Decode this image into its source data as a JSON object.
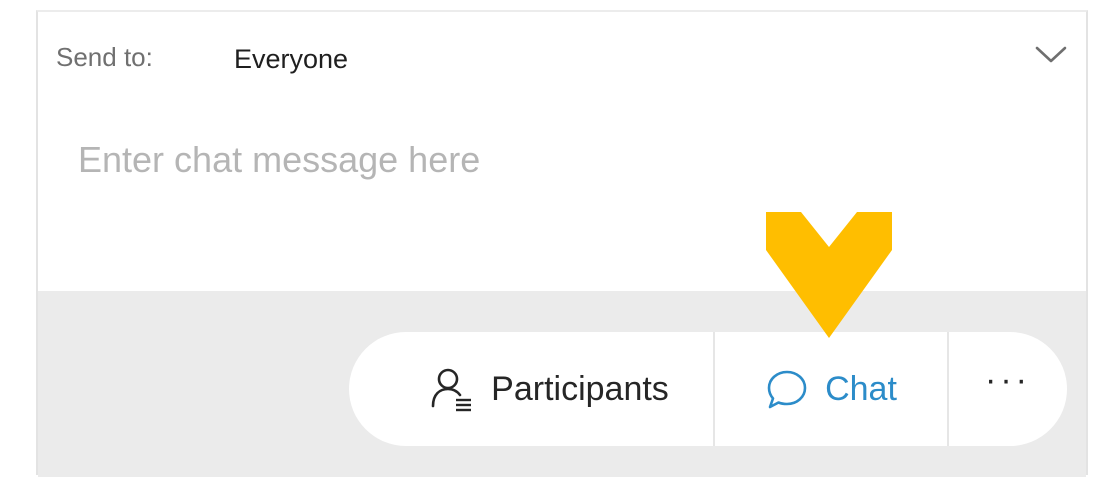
{
  "send_to": {
    "label": "Send to:",
    "value": "Everyone",
    "dropdown_icon": "chevron-down-icon"
  },
  "message": {
    "placeholder": "Enter chat message here",
    "value": ""
  },
  "toolbar": {
    "participants": {
      "label": "Participants",
      "icon": "participants-icon"
    },
    "chat": {
      "label": "Chat",
      "icon": "chat-bubble-icon",
      "active": true
    },
    "more": {
      "label": "···",
      "icon": "more-options-icon"
    }
  },
  "highlight": {
    "icon": "pointer-arrow-icon",
    "color": "#FFBE00"
  },
  "colors": {
    "accent": "#2C8CC9",
    "footer_bg": "#EBEBEB",
    "highlight": "#FFBE00"
  }
}
